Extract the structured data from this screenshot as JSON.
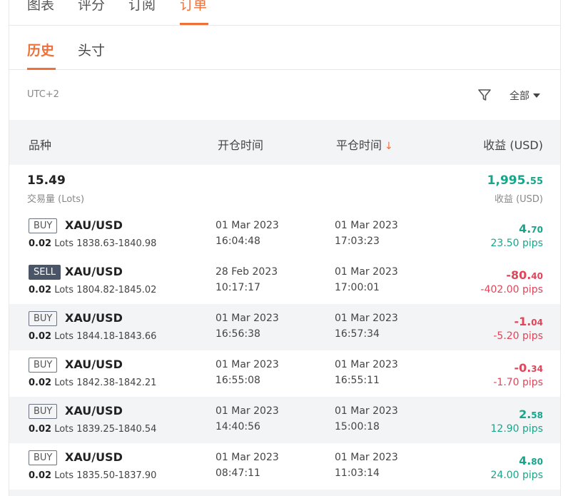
{
  "top_tabs": [
    {
      "label": "图表",
      "active": false
    },
    {
      "label": "评分",
      "active": false
    },
    {
      "label": "订阅",
      "active": false
    },
    {
      "label": "订单",
      "active": true
    }
  ],
  "sub_tabs": [
    {
      "label": "历史",
      "active": true
    },
    {
      "label": "头寸",
      "active": false
    }
  ],
  "filter": {
    "timezone": "UTC+2",
    "filter_icon": "filter-icon",
    "dropdown_value": "全部"
  },
  "table": {
    "headers": {
      "symbol": "品种",
      "open_time": "开仓时间",
      "close_time": "平仓时间",
      "close_sort_indicator": "↓",
      "profit": "收益 (USD)"
    },
    "summary": {
      "volume": "15.49",
      "volume_label": "交易量 (Lots)",
      "profit_main": "1,995.",
      "profit_cents": "55",
      "profit_label": "收益 (USD)"
    },
    "rows": [
      {
        "side": "BUY",
        "symbol": "XAU/USD",
        "lots": "0.02",
        "lots_unit": "Lots",
        "price_range": "1838.63-1840.98",
        "open_date": "01 Mar 2023",
        "open_time": "16:04:48",
        "close_date": "01 Mar 2023",
        "close_time": "17:03:23",
        "profit_main": "4.",
        "profit_cents": "70",
        "pips": "23.50 pips",
        "positive": true
      },
      {
        "side": "SELL",
        "symbol": "XAU/USD",
        "lots": "0.02",
        "lots_unit": "Lots",
        "price_range": "1804.82-1845.02",
        "open_date": "28 Feb 2023",
        "open_time": "10:17:17",
        "close_date": "01 Mar 2023",
        "close_time": "17:00:01",
        "profit_main": "-80.",
        "profit_cents": "40",
        "pips": "-402.00 pips",
        "positive": false
      },
      {
        "side": "BUY",
        "symbol": "XAU/USD",
        "lots": "0.02",
        "lots_unit": "Lots",
        "price_range": "1844.18-1843.66",
        "open_date": "01 Mar 2023",
        "open_time": "16:56:38",
        "close_date": "01 Mar 2023",
        "close_time": "16:57:34",
        "profit_main": "-1.",
        "profit_cents": "04",
        "pips": "-5.20 pips",
        "positive": false
      },
      {
        "side": "BUY",
        "symbol": "XAU/USD",
        "lots": "0.02",
        "lots_unit": "Lots",
        "price_range": "1842.38-1842.21",
        "open_date": "01 Mar 2023",
        "open_time": "16:55:08",
        "close_date": "01 Mar 2023",
        "close_time": "16:55:11",
        "profit_main": "-0.",
        "profit_cents": "34",
        "pips": "-1.70 pips",
        "positive": false
      },
      {
        "side": "BUY",
        "symbol": "XAU/USD",
        "lots": "0.02",
        "lots_unit": "Lots",
        "price_range": "1839.25-1840.54",
        "open_date": "01 Mar 2023",
        "open_time": "14:40:56",
        "close_date": "01 Mar 2023",
        "close_time": "15:00:18",
        "profit_main": "2.",
        "profit_cents": "58",
        "pips": "12.90 pips",
        "positive": true
      },
      {
        "side": "BUY",
        "symbol": "XAU/USD",
        "lots": "0.02",
        "lots_unit": "Lots",
        "price_range": "1835.50-1837.90",
        "open_date": "01 Mar 2023",
        "open_time": "08:47:11",
        "close_date": "01 Mar 2023",
        "close_time": "11:03:14",
        "profit_main": "4.",
        "profit_cents": "80",
        "pips": "24.00 pips",
        "positive": true
      }
    ]
  },
  "colors": {
    "accent": "#f0703a",
    "positive": "#1aa58a",
    "negative": "#e0455a",
    "row_alt_bg": "#f3f4f6"
  }
}
